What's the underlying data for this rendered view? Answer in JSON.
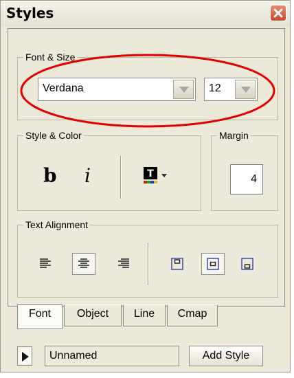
{
  "window": {
    "title": "Styles"
  },
  "font_size": {
    "legend": "Font & Size",
    "font": "Verdana",
    "size": "12"
  },
  "style_color": {
    "legend": "Style & Color",
    "bold_label": "b",
    "italic_label": "i"
  },
  "margin": {
    "legend": "Margin",
    "value": "4"
  },
  "text_alignment": {
    "legend": "Text Alignment"
  },
  "tabs": [
    {
      "label": "Font",
      "active": true
    },
    {
      "label": "Object",
      "active": false
    },
    {
      "label": "Line",
      "active": false
    },
    {
      "label": "Cmap",
      "active": false
    }
  ],
  "bottom": {
    "style_name": "Unnamed",
    "add_style_label": "Add Style"
  },
  "colors": {
    "highlight_ellipse": "#e00000",
    "window_bg": "#ece9d8",
    "alignment_icon": "#3b4aa8"
  },
  "icons": [
    "close-icon",
    "dropdown-arrow-icon",
    "text-color-icon",
    "align-left-icon",
    "align-center-icon",
    "align-right-icon",
    "vertical-align-top-icon",
    "vertical-align-middle-icon",
    "vertical-align-bottom-icon",
    "play-icon"
  ]
}
